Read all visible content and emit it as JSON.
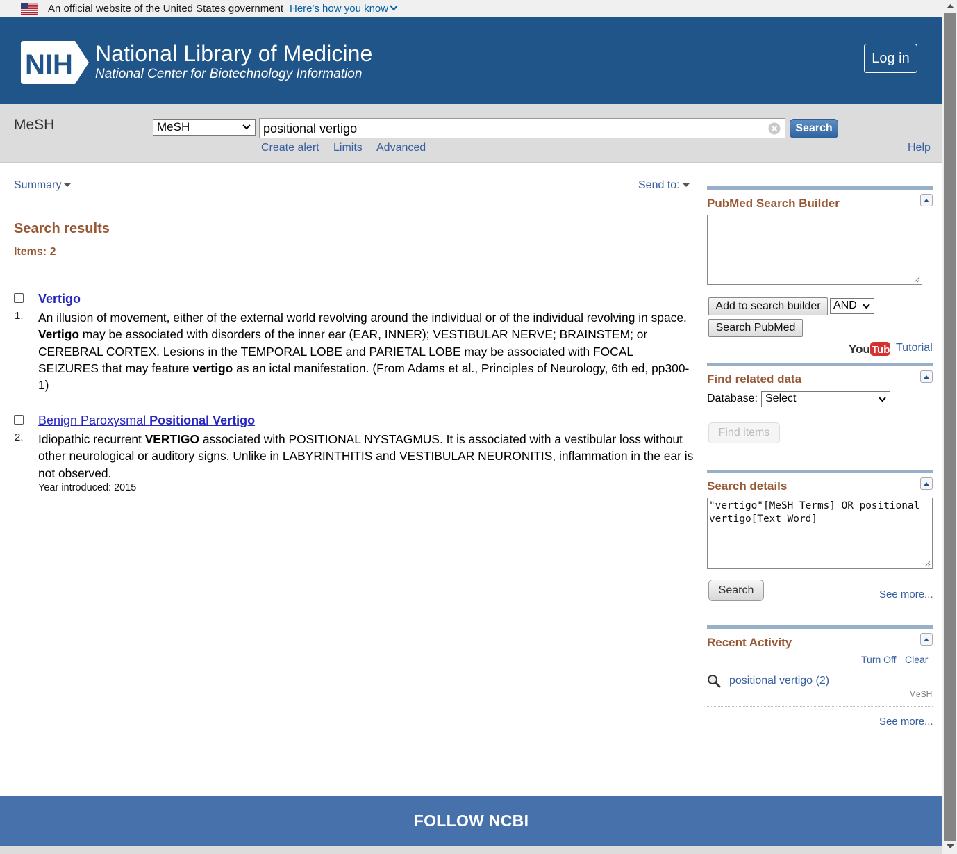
{
  "gov_banner": {
    "text": "An official website of the United States government",
    "link": "Here's how you know"
  },
  "header": {
    "logo_text": "NIH",
    "title": "National Library of Medicine",
    "subtitle": "National Center for Biotechnology Information",
    "login": "Log in"
  },
  "search": {
    "db_name": "MeSH",
    "db_select": "MeSH",
    "term": "positional vertigo",
    "button": "Search",
    "links": [
      "Create alert",
      "Limits",
      "Advanced"
    ],
    "help": "Help"
  },
  "results": {
    "summary": "Summary",
    "send_to": "Send to:",
    "heading": "Search results",
    "items": "Items: 2",
    "list": [
      {
        "number": "1.",
        "title": "Vertigo",
        "description_html": "An illusion of movement, either of the external world revolving around the individual or of the individual revolving in space. <b>Vertigo</b> may be associated with disorders of the inner ear (EAR, INNER); VESTIBULAR NERVE; BRAINSTEM; or CEREBRAL CORTEX. Lesions in the TEMPORAL LOBE and PARIETAL LOBE may be associated with FOCAL SEIZURES that may feature <b>vertigo</b> as an ictal manifestation. (From Adams et al., Principles of Neurology, 6th ed, pp300-1)"
      },
      {
        "number": "2.",
        "title_html": "Benign Paroxysmal <b>Positional Vertigo</b>",
        "description_html": "Idiopathic recurrent <b>VERTIGO</b> associated with POSITIONAL NYSTAGMUS. It is associated with a vestibular loss without other neurological or auditory signs. Unlike in LABYRINTHITIS and VESTIBULAR NEURONITIS, inflammation in the ear is not observed.",
        "year": "Year introduced: 2015"
      }
    ]
  },
  "sidebar": {
    "builder": {
      "title": "PubMed Search Builder",
      "add_button": "Add to search builder",
      "operator": "AND",
      "search_button": "Search PubMed",
      "tutorial": "Tutorial"
    },
    "related": {
      "title": "Find related data",
      "db_label": "Database:",
      "db_select": "Select",
      "find_button": "Find items"
    },
    "details": {
      "title": "Search details",
      "query": "\"vertigo\"[MeSH Terms] OR positional\nvertigo[Text Word]",
      "search_button": "Search",
      "see_more": "See more..."
    },
    "activity": {
      "title": "Recent Activity",
      "turn_off": "Turn Off",
      "clear": "Clear",
      "item": "positional vertigo (2)",
      "item_db": "MeSH",
      "see_more": "See more..."
    }
  },
  "footer": {
    "title": "FOLLOW NCBI"
  },
  "colors": {
    "header_bg": "#20558a",
    "accent_brown": "#985735",
    "link_blue": "#375fa0",
    "footer_bg": "#4671aa"
  }
}
